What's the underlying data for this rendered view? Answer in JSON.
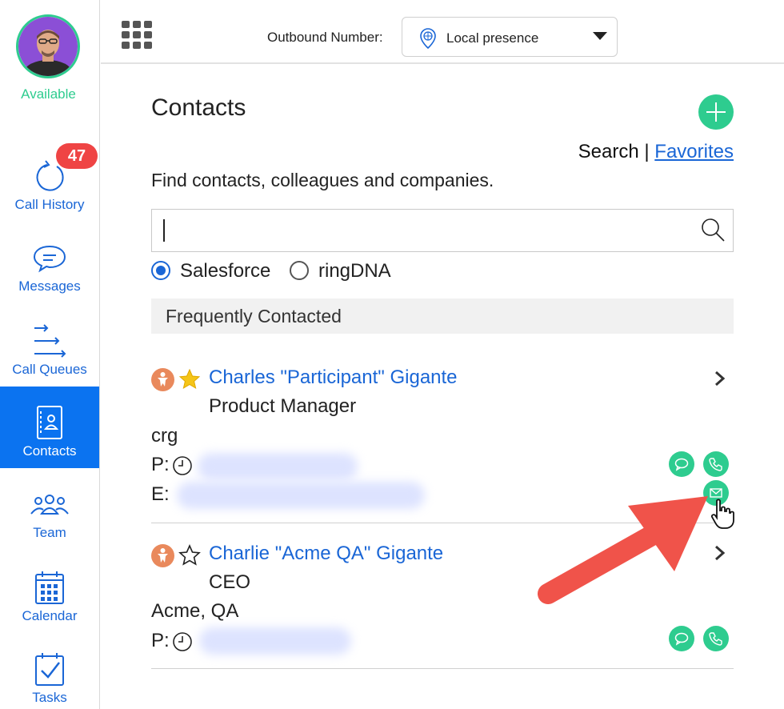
{
  "sidebar": {
    "status": "Available",
    "call_history_badge": "47",
    "items": [
      {
        "label": "Call History"
      },
      {
        "label": "Messages"
      },
      {
        "label": "Call Queues"
      },
      {
        "label": "Contacts"
      },
      {
        "label": "Team"
      },
      {
        "label": "Calendar"
      },
      {
        "label": "Tasks"
      }
    ]
  },
  "header": {
    "outbound_label": "Outbound Number:",
    "outbound_value": "Local presence"
  },
  "main": {
    "title": "Contacts",
    "search_label": "Search",
    "separator": "|",
    "favorites_label": "Favorites",
    "subtitle": "Find contacts, colleagues and companies.",
    "search_value": "",
    "radio_options": [
      {
        "label": "Salesforce",
        "checked": true
      },
      {
        "label": "ringDNA",
        "checked": false
      }
    ],
    "section_header": "Frequently Contacted",
    "contacts": [
      {
        "name": "Charles \"Participant\" Gigante",
        "title": "Product Manager",
        "company": "crg",
        "favorite": true,
        "phone_label": "P:",
        "email_label": "E:"
      },
      {
        "name": "Charlie \"Acme QA\" Gigante",
        "title": "CEO",
        "company": "Acme, QA",
        "favorite": false,
        "phone_label": "P:"
      }
    ]
  },
  "colors": {
    "accent_blue": "#0b73f0",
    "link_blue": "#1a66d6",
    "green": "#2ecc8f",
    "badge_red": "#ef4444",
    "arrow_red": "#f0534a"
  }
}
